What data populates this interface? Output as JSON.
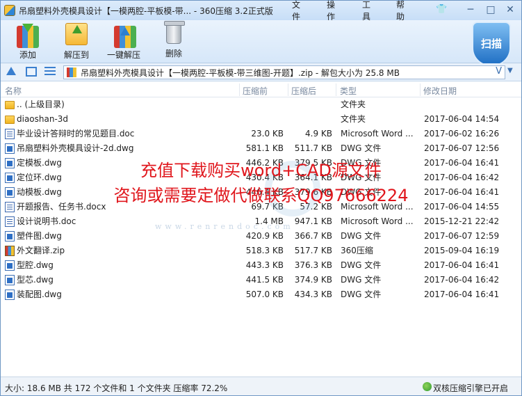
{
  "window": {
    "title": "吊扇塑料外壳模具设计【一模两腔-平板模-带... - 360压缩 3.2正式版",
    "menus": [
      "文件",
      "操作",
      "工具",
      "帮助"
    ],
    "controls": {
      "minimize": "─",
      "maximize": "□",
      "close": "✕"
    }
  },
  "toolbar": {
    "buttons": [
      {
        "label": "添加",
        "icon": "add-books-icon"
      },
      {
        "label": "解压到",
        "icon": "extract-to-icon"
      },
      {
        "label": "一键解压",
        "icon": "one-click-extract-icon"
      },
      {
        "label": "删除",
        "icon": "trash-icon"
      }
    ],
    "scan_label": "扫描"
  },
  "address": {
    "text": "吊扇塑料外壳模具设计【一模两腔-平板模-带三维图-开题】.zip - 解包大小为 25.8 MB",
    "drop": "V"
  },
  "columns": {
    "name": "名称",
    "packed": "压缩前",
    "unpacked": "压缩后",
    "type": "类型",
    "modified": "修改日期"
  },
  "files": [
    {
      "icon": "folder",
      "name": ".. (上级目录)",
      "size": "",
      "packed": "",
      "type": "文件夹",
      "date": ""
    },
    {
      "icon": "folder",
      "name": "diaoshan-3d",
      "size": "",
      "packed": "",
      "type": "文件夹",
      "date": "2017-06-04 14:54"
    },
    {
      "icon": "doc",
      "name": "毕业设计答辩时的常见题目.doc",
      "size": "23.0 KB",
      "packed": "4.9 KB",
      "type": "Microsoft Word ...",
      "date": "2017-06-02 16:26"
    },
    {
      "icon": "dwg",
      "name": "吊扇塑料外壳模具设计-2d.dwg",
      "size": "581.1 KB",
      "packed": "511.7 KB",
      "type": "DWG 文件",
      "date": "2017-06-07 12:56"
    },
    {
      "icon": "dwg",
      "name": "定模板.dwg",
      "size": "446.2 KB",
      "packed": "379.5 KB",
      "type": "DWG 文件",
      "date": "2017-06-04 16:41"
    },
    {
      "icon": "dwg",
      "name": "定位环.dwg",
      "size": "430.4 KB",
      "packed": "364.1 KB",
      "type": "DWG 文件",
      "date": "2017-06-04 16:42"
    },
    {
      "icon": "dwg",
      "name": "动模板.dwg",
      "size": "446.4 KB",
      "packed": "379.6 KB",
      "type": "DWG 文件",
      "date": "2017-06-04 16:41"
    },
    {
      "icon": "doc",
      "name": "开题报告、任务书.docx",
      "size": "69.7 KB",
      "packed": "57.2 KB",
      "type": "Microsoft Word ...",
      "date": "2017-06-04 14:55"
    },
    {
      "icon": "doc",
      "name": "设计说明书.doc",
      "size": "1.4 MB",
      "packed": "947.1 KB",
      "type": "Microsoft Word ...",
      "date": "2015-12-21 22:42"
    },
    {
      "icon": "dwg",
      "name": "塑件图.dwg",
      "size": "420.9 KB",
      "packed": "366.7 KB",
      "type": "DWG 文件",
      "date": "2017-06-07 12:59"
    },
    {
      "icon": "zip",
      "name": "外文翻译.zip",
      "size": "518.3 KB",
      "packed": "517.7 KB",
      "type": "360压缩",
      "date": "2015-09-04 16:19"
    },
    {
      "icon": "dwg",
      "name": "型腔.dwg",
      "size": "443.3 KB",
      "packed": "376.3 KB",
      "type": "DWG 文件",
      "date": "2017-06-04 16:41"
    },
    {
      "icon": "dwg",
      "name": "型芯.dwg",
      "size": "441.5 KB",
      "packed": "374.9 KB",
      "type": "DWG 文件",
      "date": "2017-06-04 16:42"
    },
    {
      "icon": "dwg",
      "name": "装配图.dwg",
      "size": "507.0 KB",
      "packed": "434.3 KB",
      "type": "DWG 文件",
      "date": "2017-06-04 16:41"
    }
  ],
  "overlay": {
    "line1": "充值下载购买word+CAD源文件",
    "line2": "咨询或需要定做代做联系QQ97666224",
    "watermark": "www.renrendoc.com"
  },
  "status": {
    "left": "大小: 18.6 MB 共 172 个文件和 1 个文件夹 压缩率 72.2%",
    "right": "双核压缩引擎已开启"
  },
  "colors": {
    "overlay_text": "#e0161c",
    "titlebar": "#c7def7",
    "accent": "#2b6fba"
  }
}
